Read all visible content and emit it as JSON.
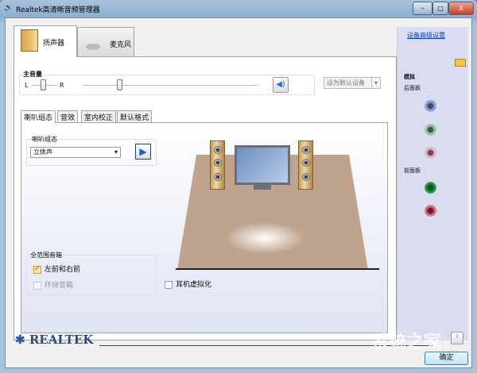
{
  "window": {
    "title": "Realtek高清晰音频管理器",
    "minimize": "–",
    "maximize": "□",
    "close": "X"
  },
  "device_tabs": [
    {
      "label": "扬声器",
      "icon": "speaker-icon"
    },
    {
      "label": "麦克风",
      "icon": "microphone-icon"
    }
  ],
  "volume": {
    "label": "主音量",
    "left": "L",
    "right": "R",
    "balance_percent": 50,
    "volume_percent": 22,
    "set_default": "设为默认设备"
  },
  "sub_tabs": [
    "喇叭组态",
    "音效",
    "室内校正",
    "默认格式"
  ],
  "speaker_config": {
    "label": "喇叭组态",
    "selected": "立体声"
  },
  "full_range": {
    "label": "全范围音箱",
    "items": [
      {
        "label": "左前和右前",
        "checked": true,
        "enabled": true
      },
      {
        "label": "环绕音箱",
        "checked": false,
        "enabled": false
      }
    ]
  },
  "headphone_virtualization": {
    "label": "耳机虚拟化",
    "checked": false
  },
  "right_panel": {
    "link": "设备高级设置",
    "analog": "模拟",
    "rear": "后面板",
    "front": "前面板",
    "rear_jacks": [
      "#7f95c8",
      "#8fb89a",
      "#d9a8b8"
    ],
    "front_jacks": [
      "#1a8a2a",
      "#d9607a"
    ]
  },
  "brand": "REALTEK",
  "ok": "确定",
  "watermark": "系统之家"
}
